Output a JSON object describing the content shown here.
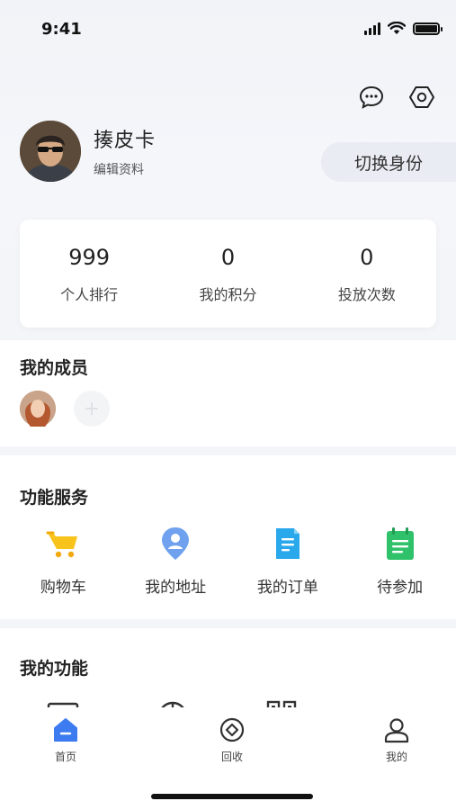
{
  "status_bar": {
    "time": "9:41"
  },
  "profile": {
    "name": "揍皮卡",
    "edit_label": "编辑资料",
    "switch_label": "切换身份"
  },
  "stats": [
    {
      "value": "999",
      "label": "个人排行"
    },
    {
      "value": "0",
      "label": "我的积分"
    },
    {
      "value": "0",
      "label": "投放次数"
    }
  ],
  "members": {
    "title": "我的成员"
  },
  "services": {
    "title": "功能服务",
    "items": [
      {
        "label": "购物车",
        "icon": "shopping-cart-icon",
        "color": "#f8c31b"
      },
      {
        "label": "我的地址",
        "icon": "location-pin-icon",
        "color": "#6fa1ef"
      },
      {
        "label": "我的订单",
        "icon": "order-document-icon",
        "color": "#2aa8ec"
      },
      {
        "label": "待参加",
        "icon": "calendar-check-icon",
        "color": "#2fc26a"
      }
    ]
  },
  "functions": {
    "title": "我的功能"
  },
  "tabbar": {
    "items": [
      {
        "label": "首页",
        "icon": "home-icon",
        "active": true
      },
      {
        "label": "回收",
        "icon": "recycle-icon",
        "active": false
      },
      {
        "label": "我的",
        "icon": "profile-icon",
        "active": false
      }
    ]
  },
  "colors": {
    "accent": "#3d7cf0",
    "background": "#f4f5f8"
  }
}
